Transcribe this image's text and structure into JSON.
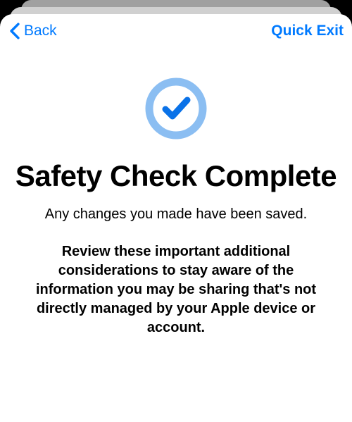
{
  "nav": {
    "back_label": "Back",
    "quick_exit_label": "Quick Exit"
  },
  "icon": {
    "ring_color": "#8BBEF2",
    "check_color": "#0A72E8"
  },
  "content": {
    "title": "Safety Check Complete",
    "subtitle": "Any changes you made have been saved.",
    "body": "Review these important additional considerations to stay aware of the information you may be sharing that's not directly managed by your Apple device or account."
  }
}
